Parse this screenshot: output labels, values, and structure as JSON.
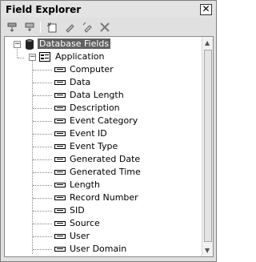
{
  "window": {
    "title": "Field Explorer",
    "close_glyph": "✕"
  },
  "toolbar": {
    "icons": [
      "insert-field-icon",
      "add-field-icon",
      "new-field-icon",
      "edit-field-icon",
      "properties-icon",
      "delete-icon"
    ]
  },
  "tree": {
    "root": {
      "label": "Database Fields",
      "expander": "−"
    },
    "group": {
      "label": "Application",
      "expander": "−"
    },
    "fields": [
      "Computer",
      "Data",
      "Data Length",
      "Description",
      "Event Category",
      "Event ID",
      "Event Type",
      "Generated Date",
      "Generated Time",
      "Length",
      "Record Number",
      "SID",
      "Source",
      "User",
      "User Domain"
    ]
  }
}
